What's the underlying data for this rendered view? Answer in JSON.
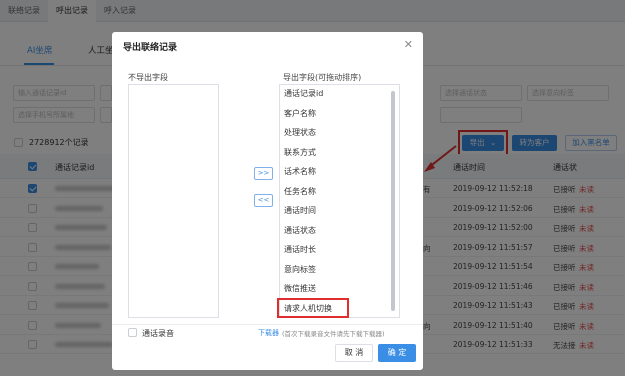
{
  "top_tabs": [
    "联络记录",
    "呼出记录",
    "呼入记录"
  ],
  "sub_tabs": [
    "AI坐席",
    "人工坐"
  ],
  "filters": {
    "row1": [
      "输入通话记录id",
      "",
      "选择通话状态",
      "选择意向标签"
    ],
    "row2": [
      "选择手机号所属地",
      "",
      ""
    ]
  },
  "record_count": "2728912个记录",
  "toolbar": {
    "export_label": "导出",
    "convert_label": "转为客户",
    "blacklist_label": "加入黑名单"
  },
  "table": {
    "headers": [
      "通话记录id",
      "通话时间",
      "通话状"
    ],
    "rows": [
      {
        "checked": true,
        "time": "2019-09-12 11:52:18",
        "status": "已接听",
        "read": "未读",
        "mid": "有"
      },
      {
        "checked": false,
        "time": "2019-09-12 11:52:06",
        "status": "已接听",
        "read": "未读",
        "mid": ""
      },
      {
        "checked": false,
        "time": "2019-09-12 11:52:00",
        "status": "已接听",
        "read": "未读",
        "mid": ""
      },
      {
        "checked": false,
        "time": "2019-09-12 11:51:57",
        "status": "已接听",
        "read": "未读",
        "mid": "向"
      },
      {
        "checked": false,
        "time": "2019-09-12 11:51:54",
        "status": "已接听",
        "read": "未读",
        "mid": ""
      },
      {
        "checked": false,
        "time": "2019-09-12 11:51:46",
        "status": "已接听",
        "read": "未读",
        "mid": ""
      },
      {
        "checked": false,
        "time": "2019-09-12 11:51:43",
        "status": "已接听",
        "read": "未读",
        "mid": ""
      },
      {
        "checked": false,
        "time": "2019-09-12 11:51:40",
        "status": "已接听",
        "read": "未读",
        "mid": "向"
      },
      {
        "checked": false,
        "time": "2019-09-12 11:51:33",
        "status": "无法接",
        "read": "未读",
        "mid": ""
      }
    ]
  },
  "modal": {
    "title": "导出联络记录",
    "close_icon": "close-icon",
    "left_label": "不导出字段",
    "right_label": "导出字段(可拖动排序)",
    "move_right": ">>",
    "move_left": "<<",
    "export_fields": [
      "通话记录id",
      "客户名称",
      "处理状态",
      "联系方式",
      "话术名称",
      "任务名称",
      "通话时间",
      "通话状态",
      "通话时长",
      "意向标签",
      "微信推送",
      "请求人机切换"
    ],
    "recording_label": "通话录音",
    "downloader_link": "下载器",
    "downloader_hint": "(首次下载录音文件请先下载下载器)",
    "cancel_label": "取 消",
    "confirm_label": "确 定"
  },
  "colors": {
    "primary": "#3a8ee6",
    "highlight": "#e02e2e",
    "unread": "#e24a4a"
  }
}
